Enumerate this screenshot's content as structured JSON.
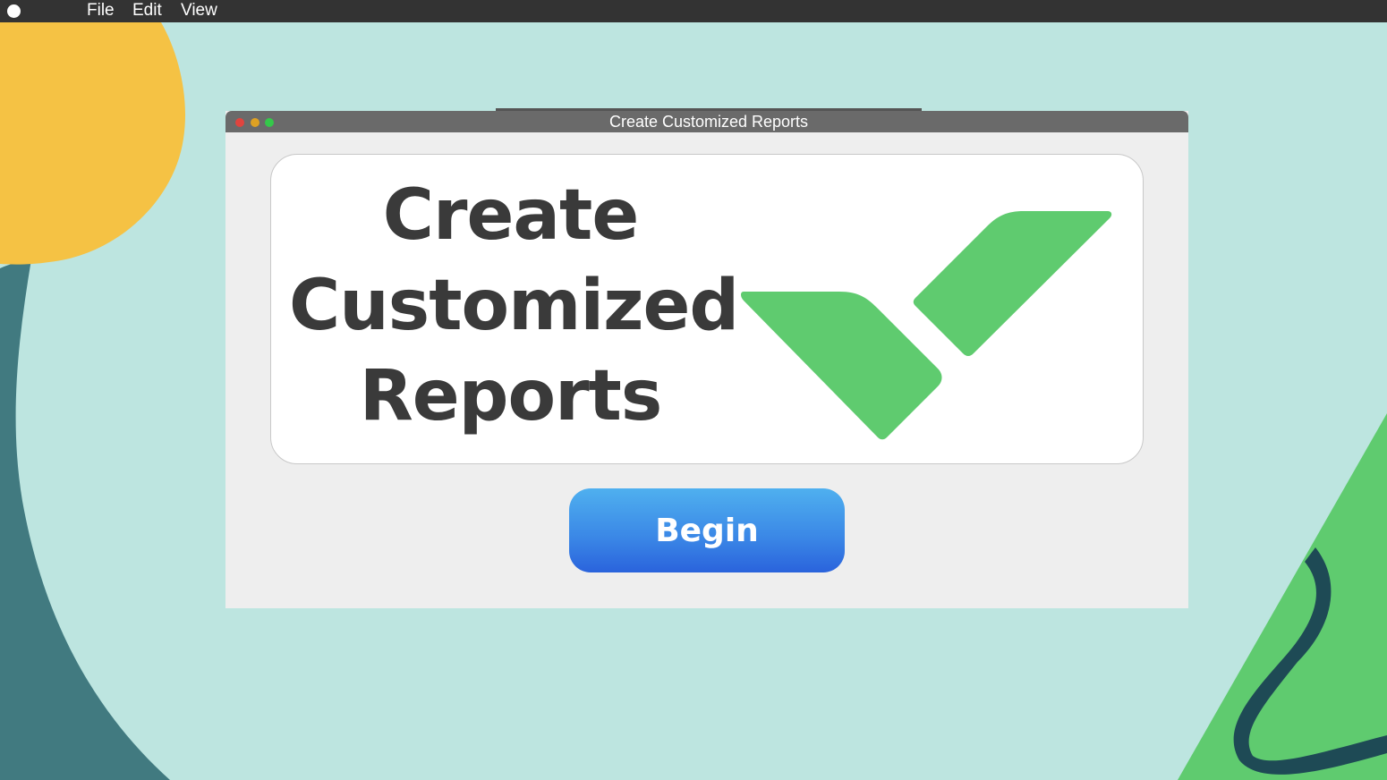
{
  "menubar": {
    "items": [
      "File",
      "Edit",
      "View"
    ]
  },
  "window": {
    "title": "Create Customized Reports"
  },
  "card": {
    "heading_lines": [
      "Create",
      "Customized",
      "Reports"
    ],
    "logo_icon": "wrike-checkmark-logo"
  },
  "actions": {
    "begin_label": "Begin"
  },
  "colors": {
    "desktop_bg": "#bde5e0",
    "menubar_bg": "#333333",
    "window_titlebar": "#6a6a6a",
    "window_body": "#eeeeee",
    "logo_green": "#5fcb6f",
    "button_blue": "#3a86e6",
    "heading_text": "#3a3a3a",
    "sun_yellow": "#f5c244",
    "teal_dark": "#417a80"
  }
}
